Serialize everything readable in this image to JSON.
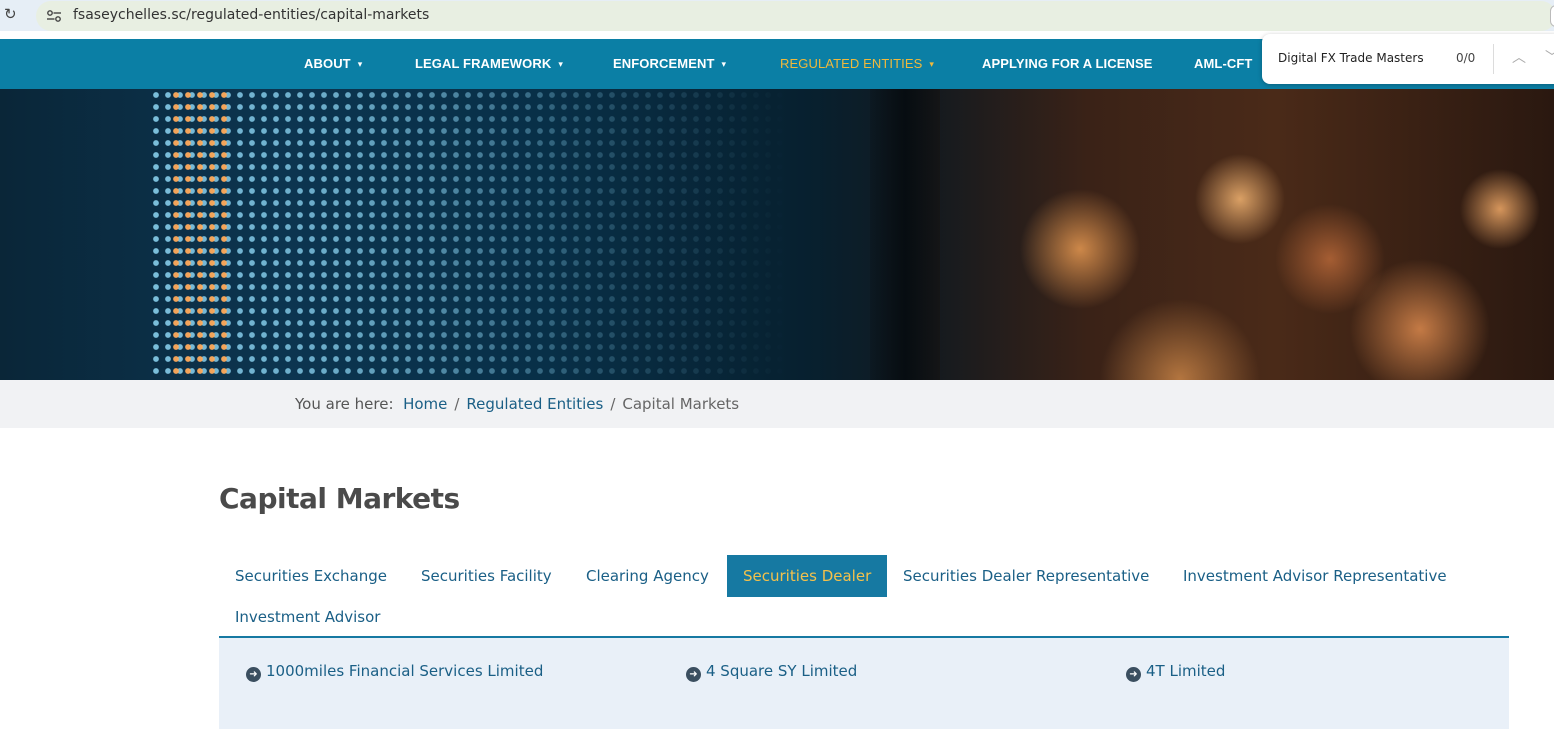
{
  "browser": {
    "url": "fsaseychelles.sc/regulated-entities/capital-markets",
    "reload_glyph": "↻"
  },
  "nav": {
    "items": [
      {
        "label": "ABOUT",
        "has_caret": true
      },
      {
        "label": "LEGAL FRAMEWORK",
        "has_caret": true
      },
      {
        "label": "ENFORCEMENT",
        "has_caret": true
      },
      {
        "label": "REGULATED ENTITIES",
        "has_caret": true,
        "active": true
      },
      {
        "label": "APPLYING FOR A LICENSE",
        "has_caret": false
      },
      {
        "label": "AML-CFT",
        "has_caret": false
      }
    ],
    "caret_glyph": "▾",
    "active_color": "#f0b93c",
    "bar_color": "#0b7fa5"
  },
  "findbar": {
    "query": "Digital FX Trade Masters",
    "count": "0/0",
    "up_glyph": "︿",
    "down_glyph": "﹀"
  },
  "breadcrumb": {
    "prefix": "You are here:",
    "items": [
      "Home",
      "Regulated Entities"
    ],
    "separator": "/",
    "current": "Capital Markets"
  },
  "page": {
    "title": "Capital Markets"
  },
  "tabs": [
    {
      "label": "Securities Exchange"
    },
    {
      "label": "Securities Facility"
    },
    {
      "label": "Clearing Agency"
    },
    {
      "label": "Securities Dealer",
      "active": true
    },
    {
      "label": "Securities Dealer Representative"
    },
    {
      "label": "Investment Advisor Representative"
    },
    {
      "label": "Investment Advisor"
    }
  ],
  "entities": [
    {
      "name": "1000miles Financial Services Limited"
    },
    {
      "name": "4 Square SY Limited"
    },
    {
      "name": "4T Limited"
    }
  ],
  "icons": {
    "entity_arrow": "➜"
  }
}
